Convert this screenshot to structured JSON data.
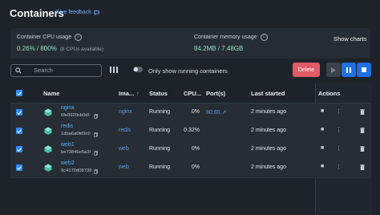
{
  "header": {
    "title": "Containers",
    "feedback_label": "Give feedback"
  },
  "stats": {
    "cpu_label": "Container CPU usage",
    "cpu_value": "0.26% / 800%",
    "cpu_sub": "(8 CPUs available)",
    "mem_label": "Container memory usage",
    "mem_value": "84.2MB / 7.48GB",
    "show_charts_label": "Show charts"
  },
  "toolbar": {
    "search_placeholder": "Search",
    "toggle_label": "Only show running containers",
    "toggle_on": false,
    "delete_label": "Delete"
  },
  "table": {
    "columns": {
      "name": "Name",
      "image": "Ima...",
      "status": "Status",
      "cpu": "CPU...",
      "ports": "Port(s)",
      "last_started": "Last started",
      "actions": "Actions"
    },
    "rows": [
      {
        "name": "nginx",
        "id": "6fe9920cb0df",
        "image": "nginx",
        "status": "Running",
        "cpu": "0%",
        "port": "80:80",
        "last_started": "2 minutes ago"
      },
      {
        "name": "redis",
        "id": "1dba6a0fd9c0",
        "image": "redis",
        "status": "Running",
        "cpu": "0.32%",
        "port": "",
        "last_started": "2 minutes ago"
      },
      {
        "name": "web1",
        "id": "be73846e5a3f",
        "image": "web",
        "status": "Running",
        "cpu": "0%",
        "port": "",
        "last_started": "2 minutes ago"
      },
      {
        "name": "web2",
        "id": "9c4170d08739",
        "image": "web",
        "status": "Running",
        "cpu": "0%",
        "port": "",
        "last_started": "2 minutes ago"
      }
    ]
  },
  "colors": {
    "accent": "#1f6fe5",
    "danger": "#e25a66",
    "link": "#60aefc",
    "metric": "#8ee0c8"
  }
}
